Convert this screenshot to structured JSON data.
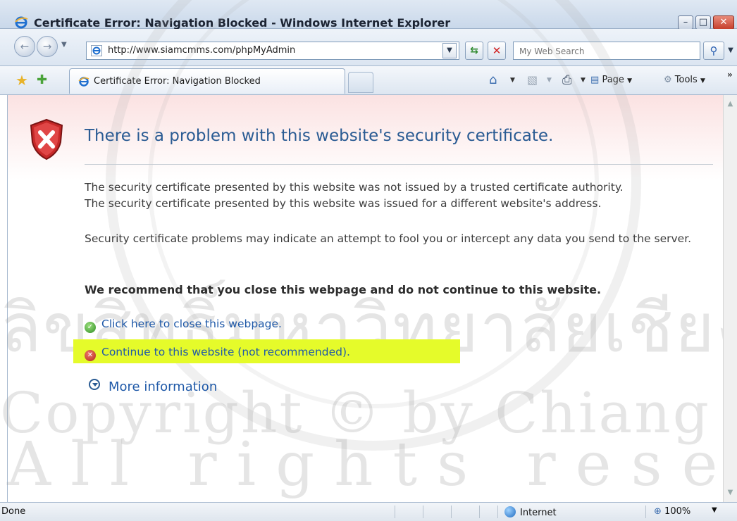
{
  "window": {
    "title": "Certificate Error: Navigation Blocked - Windows Internet Explorer",
    "min_glyph": "–",
    "max_glyph": "□",
    "close_glyph": "✕"
  },
  "address_bar": {
    "url": "http://www.siamcmms.com/phpMyAdmin",
    "search_placeholder": "My Web Search"
  },
  "tab": {
    "label": "Certificate Error: Navigation Blocked"
  },
  "command_bar": {
    "page_label": "Page",
    "tools_label": "Tools"
  },
  "content": {
    "heading": "There is a problem with this website's security certificate.",
    "lines": [
      "The security certificate presented by this website was not issued by a trusted certificate authority.",
      "The security certificate presented by this website was issued for a different website's address.",
      "Security certificate problems may indicate an attempt to fool you or intercept any data you send to the server."
    ],
    "recommendation": "We recommend that you close this webpage and do not continue to this website.",
    "close_link": "Click here to close this webpage.",
    "continue_link": "Continue to this website (not recommended).",
    "more_info": "More information"
  },
  "watermark": {
    "line1": "ลิขสิทธิ์มหาวิทยาลัยเชียงใหม่",
    "line2": "Copyright © by Chiang Mai University",
    "line3": "All rights reserved"
  },
  "status_bar": {
    "status": "Done",
    "zone": "Internet",
    "zoom": "100%"
  },
  "colors": {
    "highlight": "#e5fb2a",
    "link": "#1f59a8",
    "heading": "#2a5b93",
    "shield_red": "#c62828"
  }
}
